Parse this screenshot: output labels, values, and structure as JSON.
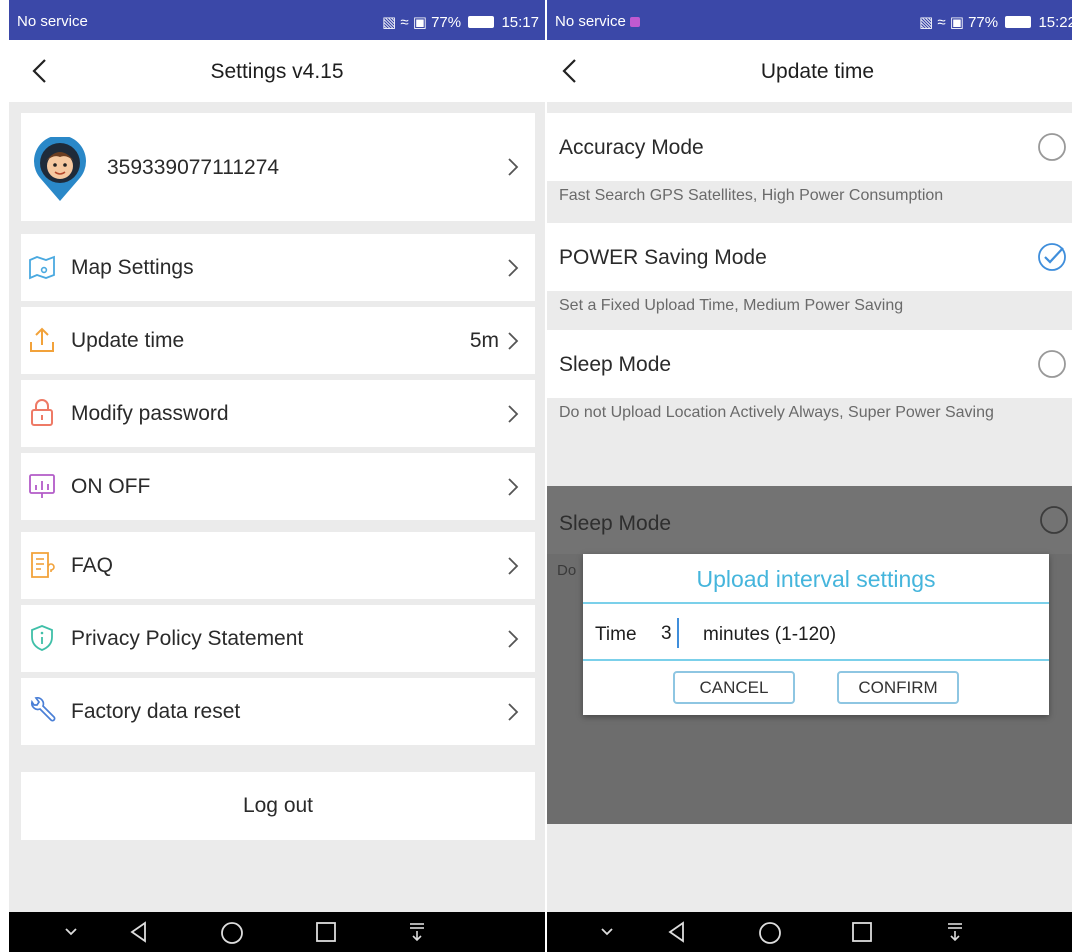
{
  "colors": {
    "status_bar": "#3b48a8",
    "accent": "#45b5dc",
    "check": "#3f8edb",
    "overlay": "#6d6d6d"
  },
  "left_screen": {
    "status": {
      "carrier": "No service",
      "battery": "77%",
      "time": "15:17"
    },
    "title": "Settings v4.15",
    "profile": {
      "device_id": "359339077111274",
      "avatar_icon": "boy-avatar-pin-icon"
    },
    "menu": [
      {
        "label": "Map Settings",
        "icon": "map-icon",
        "value": ""
      },
      {
        "label": "Update time",
        "icon": "upload-icon",
        "value": "5m"
      },
      {
        "label": "Modify password",
        "icon": "lock-icon",
        "value": ""
      },
      {
        "label": "ON OFF",
        "icon": "monitor-chart-icon",
        "value": ""
      },
      {
        "label": "FAQ",
        "icon": "faq-document-icon",
        "value": ""
      },
      {
        "label": "Privacy Policy Statement",
        "icon": "shield-icon",
        "value": ""
      },
      {
        "label": "Factory data reset",
        "icon": "wrench-icon",
        "value": ""
      }
    ],
    "logout": "Log out"
  },
  "right_screen": {
    "status": {
      "carrier": "No service",
      "battery": "77%",
      "time": "15:22"
    },
    "title": "Update time",
    "modes": [
      {
        "label": "Accuracy Mode",
        "desc": "Fast Search GPS Satellites, High Power Consumption",
        "selected": false
      },
      {
        "label": "POWER Saving Mode",
        "desc": "Set a Fixed Upload Time, Medium Power Saving",
        "selected": true
      },
      {
        "label": "Sleep Mode",
        "desc": "Do not Upload Location Actively Always, Super Power Saving",
        "selected": false
      }
    ],
    "overlay": {
      "label": "Sleep Mode",
      "peek": "Do"
    },
    "dialog": {
      "title": "Upload interval settings",
      "time_label": "Time",
      "time_value": "3",
      "unit": "minutes (1-120)",
      "cancel": "CANCEL",
      "confirm": "CONFIRM"
    }
  }
}
